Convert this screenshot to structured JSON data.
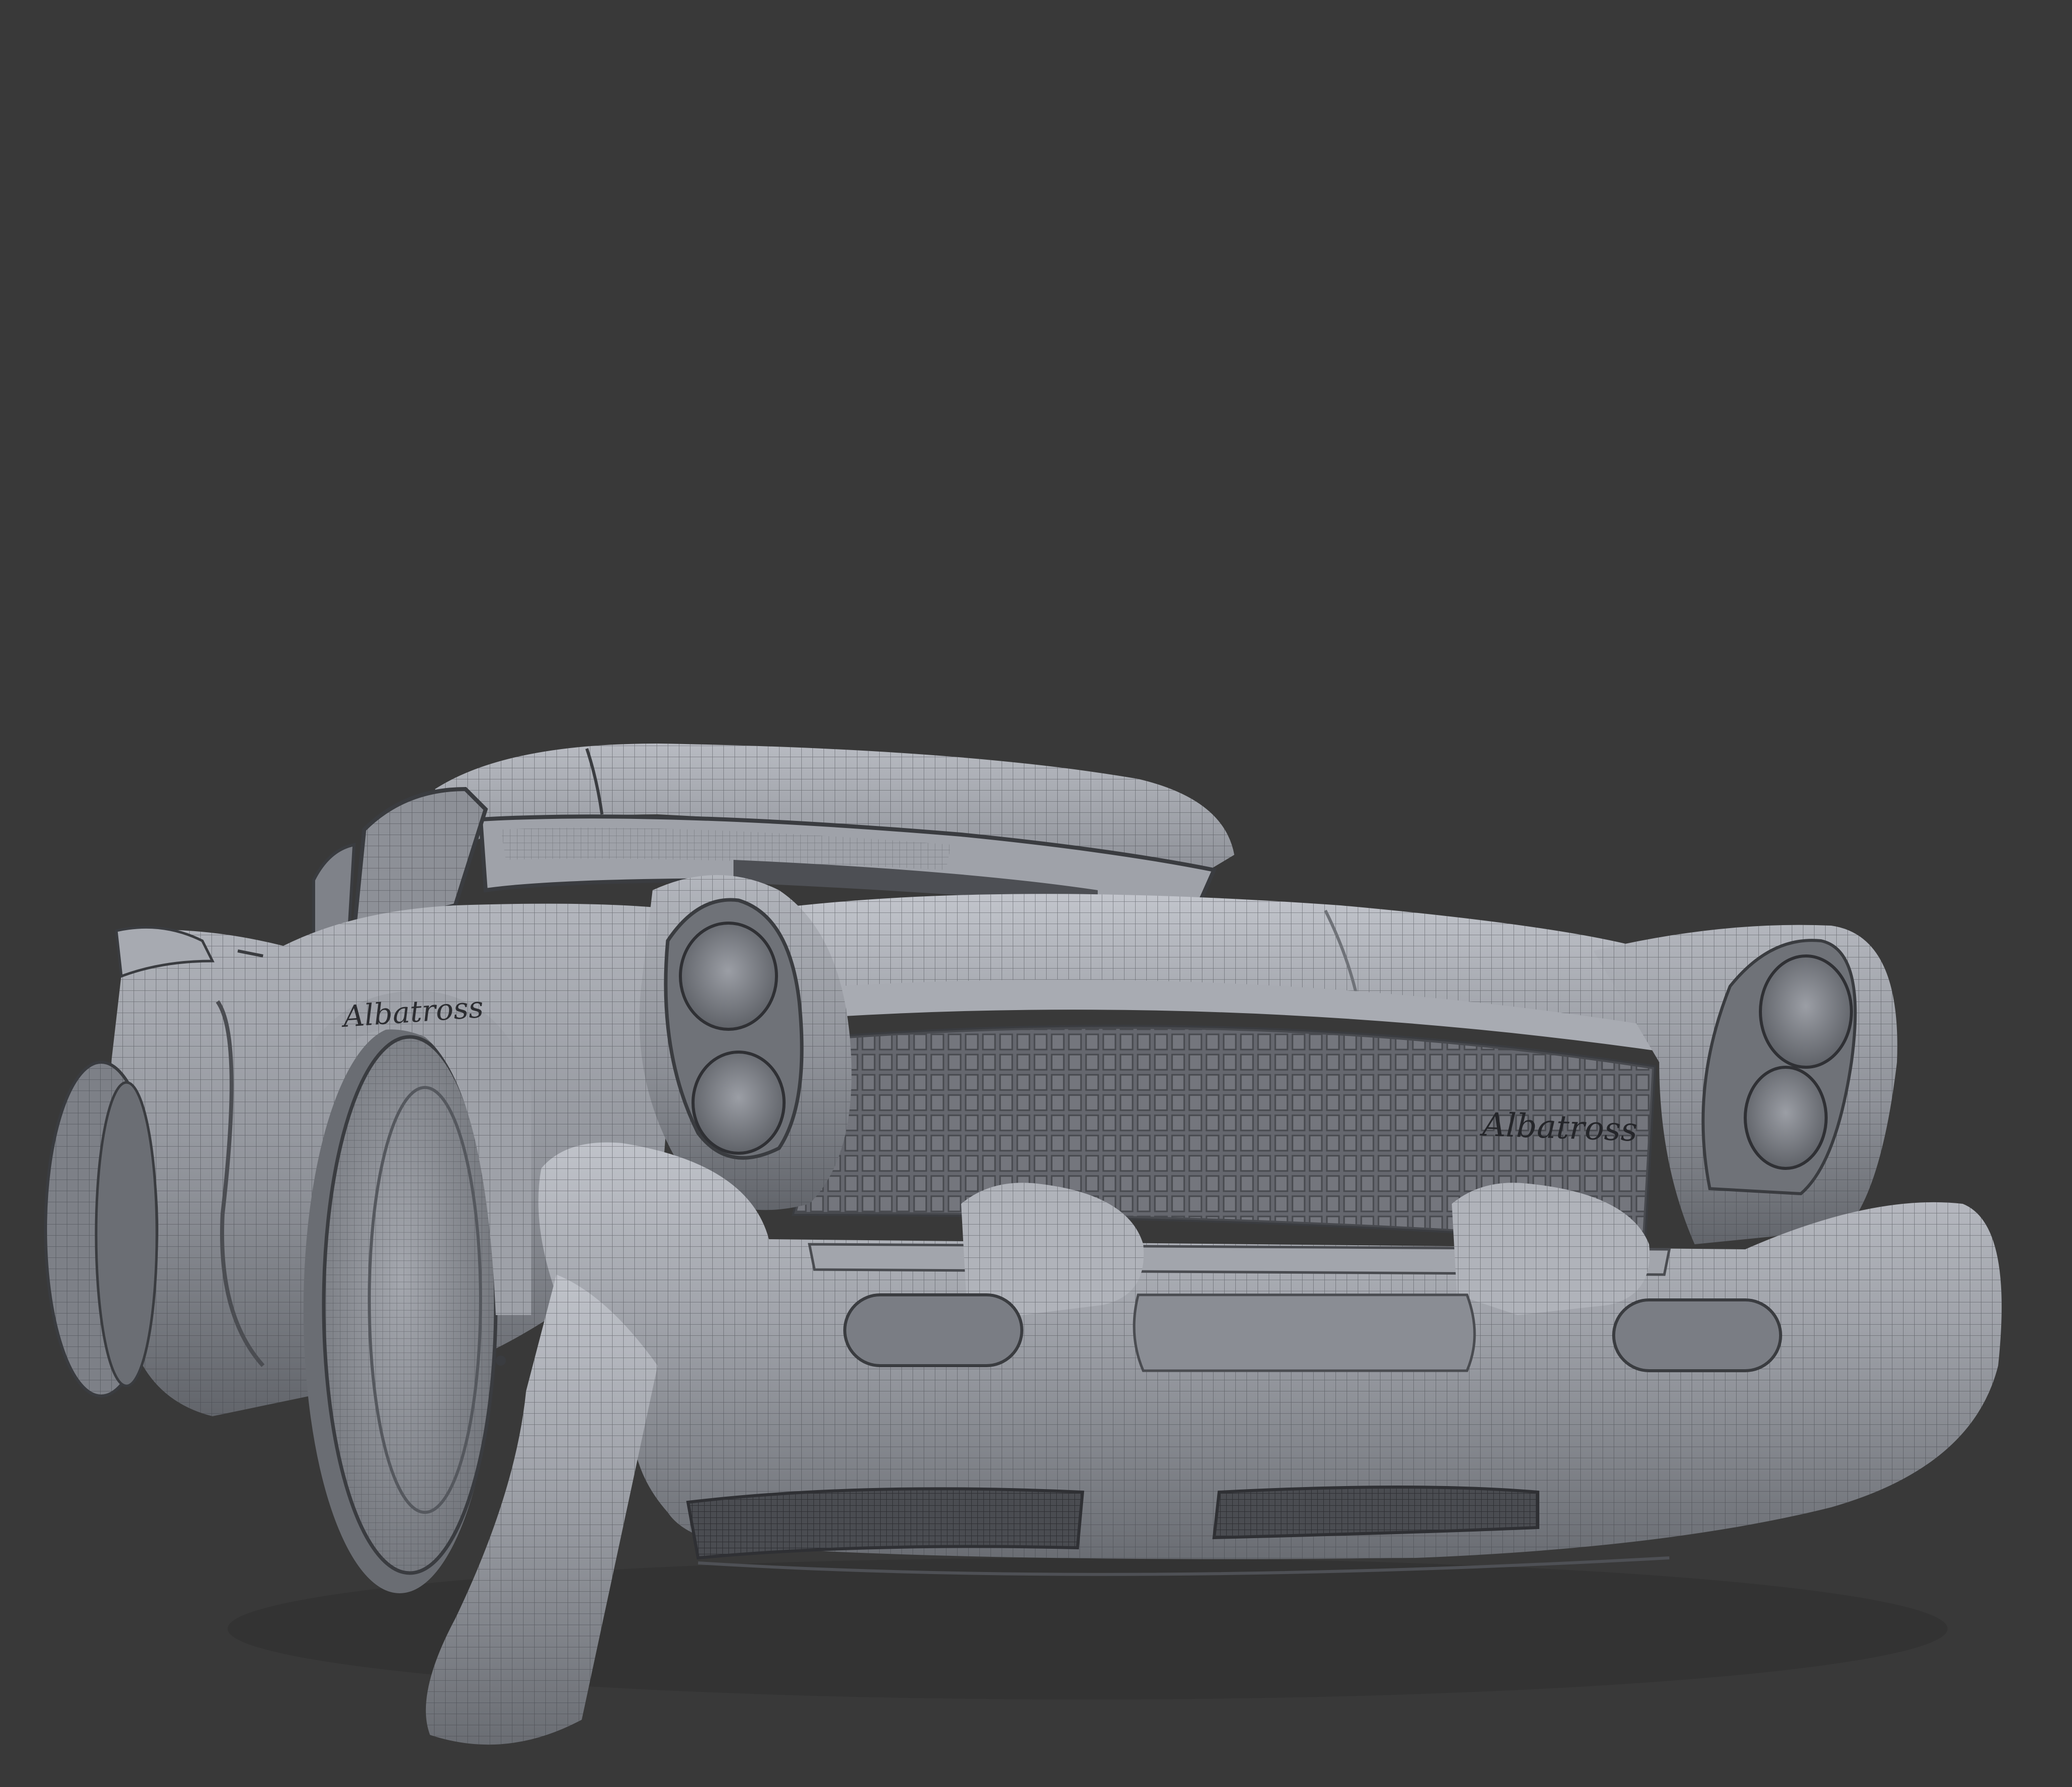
{
  "scene": {
    "background_color": "#393939",
    "model_color": "#8b8e95",
    "model_highlight": "#b9bcc3",
    "model_shadow": "#55585e",
    "wire_color": "#3c3e43",
    "subject": "wireframe-render-car"
  },
  "badges": {
    "grille_script": "Albatross",
    "fender_script": "Albatross"
  }
}
